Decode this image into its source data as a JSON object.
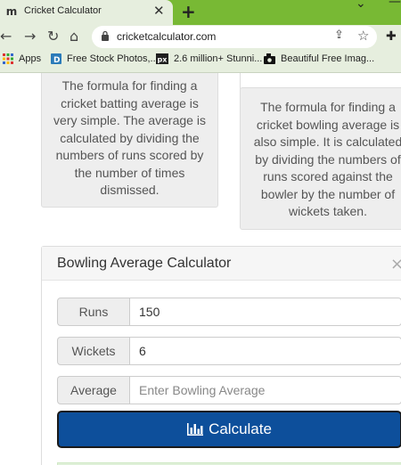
{
  "browser": {
    "tab": {
      "title": "Cricket Calculator"
    },
    "address": {
      "url": "cricketcalculator.com"
    },
    "bookmarks": [
      {
        "label": "Apps",
        "icon": "apps-grid-icon"
      },
      {
        "label": "Free Stock Photos,...",
        "icon": "d-favicon-icon"
      },
      {
        "label": "2.6 million+ Stunni...",
        "icon": "px-favicon-icon"
      },
      {
        "label": "Beautiful Free Imag...",
        "icon": "camera-favicon-icon"
      }
    ]
  },
  "cards": {
    "batting_text": "The formula for finding a cricket batting average is very simple. The average is calculated by dividing the numbers of runs scored by the number of times dismissed.",
    "bowling_text": "The formula for finding a cricket bowling average is also simple. It is calculated by dividing the numbers of runs scored against the bowler by the number of wickets taken."
  },
  "calculator": {
    "title": "Bowling Average Calculator",
    "close_symbol": "×",
    "runs": {
      "label": "Runs",
      "value": "150"
    },
    "wickets": {
      "label": "Wickets",
      "value": "6"
    },
    "average": {
      "label": "Average",
      "value": "",
      "placeholder": "Enter Bowling Average"
    },
    "button_label": "Calculate"
  },
  "colors": {
    "tabbar": "#78b934",
    "toolbar": "#e6eede",
    "button": "#0d4f9b"
  }
}
